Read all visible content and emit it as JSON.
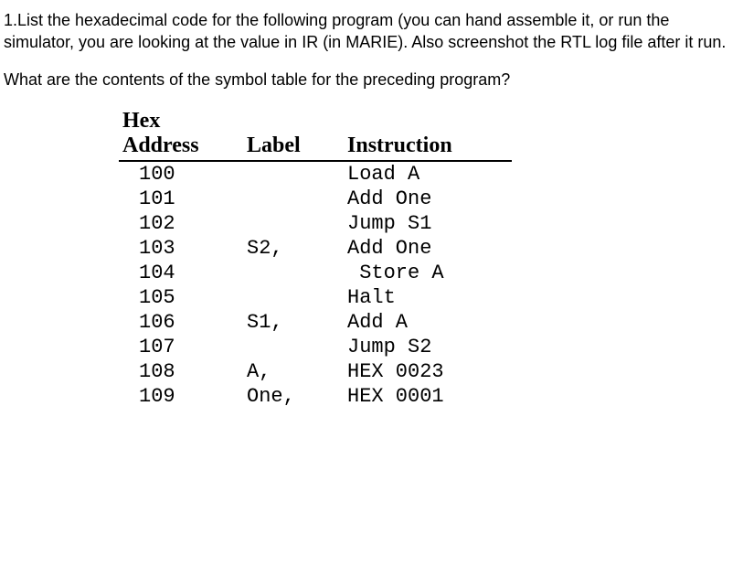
{
  "question": {
    "para1": "1.List the hexadecimal code for the following program (you can hand assemble it, or run the simulator, you are looking at the value in IR (in MARIE).  Also screenshot the RTL log file after it run.",
    "para2": "What are the contents of the symbol table for the preceding program?"
  },
  "table": {
    "headers": {
      "col1_line1": "Hex",
      "col1_line2": "Address",
      "col2": "Label",
      "col3": "Instruction"
    },
    "rows": [
      {
        "address": "100",
        "label": "",
        "instruction": "Load A"
      },
      {
        "address": "101",
        "label": "",
        "instruction": "Add One"
      },
      {
        "address": "102",
        "label": "",
        "instruction": "Jump S1"
      },
      {
        "address": "103",
        "label": "S2,",
        "instruction": "Add One"
      },
      {
        "address": "104",
        "label": "",
        "instruction": " Store A"
      },
      {
        "address": "105",
        "label": "",
        "instruction": "Halt"
      },
      {
        "address": "106",
        "label": "S1,",
        "instruction": "Add A"
      },
      {
        "address": "107",
        "label": "",
        "instruction": "Jump S2"
      },
      {
        "address": "108",
        "label": "A,",
        "instruction": "HEX 0023"
      },
      {
        "address": "109",
        "label": "One,",
        "instruction": "HEX 0001"
      }
    ]
  }
}
